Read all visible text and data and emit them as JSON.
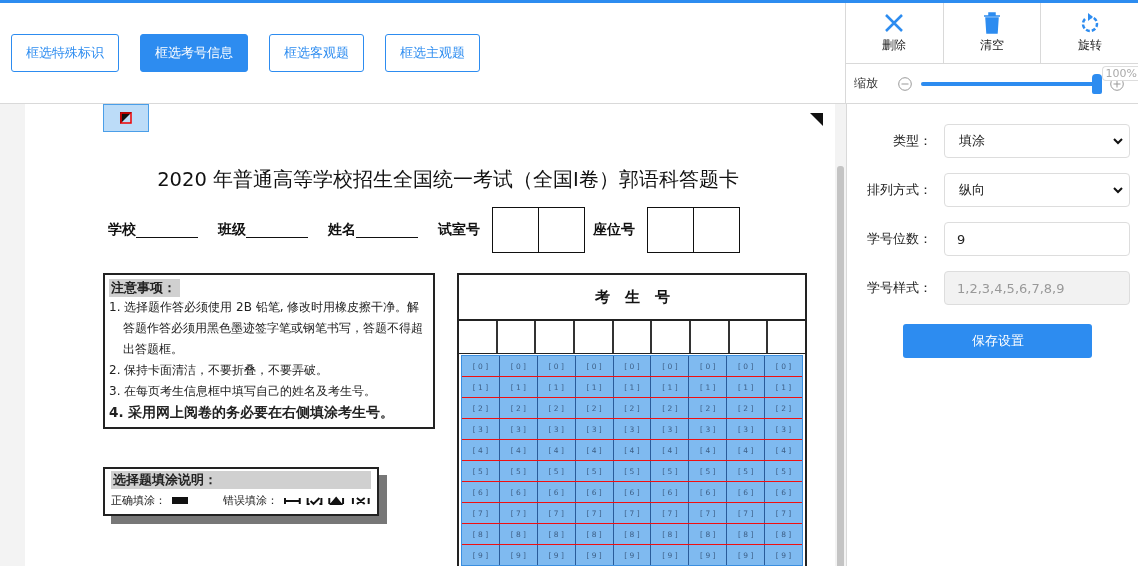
{
  "toolbar": {
    "buttons": [
      {
        "label": "框选特殊标识",
        "selected": false
      },
      {
        "label": "框选考号信息",
        "selected": true
      },
      {
        "label": "框选客观题",
        "selected": false
      },
      {
        "label": "框选主观题",
        "selected": false
      }
    ]
  },
  "tools": [
    {
      "kind": "delete",
      "label": "删除"
    },
    {
      "kind": "clear",
      "label": "清空"
    },
    {
      "kind": "rotate",
      "label": "旋转"
    }
  ],
  "zoom": {
    "label": "缩放",
    "level": 0.98,
    "reading": "100%"
  },
  "document": {
    "title": "2020 年普通高等学校招生全国统一考试（全国I卷）郭语科答题卡",
    "info": [
      {
        "kind": "line",
        "label": "学校"
      },
      {
        "kind": "line",
        "label": "班级"
      },
      {
        "kind": "line",
        "label": "姓名"
      },
      {
        "kind": "boxes",
        "label": "试室号"
      },
      {
        "kind": "boxes",
        "label": "座位号"
      }
    ],
    "notes": {
      "title": "注意事项：",
      "items": [
        {
          "text": "1. 选择题作答必须使用 2B 铅笔, 修改时用橡皮擦干净。解答题作答必须用黑色墨迹签字笔或钢笔书写，答题不得超出答题框。",
          "bold": false
        },
        {
          "text": "2. 保持卡面清洁，不要折叠，不要弄破。",
          "bold": false
        },
        {
          "text": "3. 在每页考生信息框中填写自己的姓名及考生号。",
          "bold": false
        },
        {
          "text": "4. 采用网上阅卷的务必要在右侧填涂考生号。",
          "bold": true
        }
      ]
    },
    "fill_guide": {
      "title": "选择题填涂说明：",
      "correct": "正确填涂：",
      "wrong": "错误填涂："
    },
    "grid": {
      "header": "考　生　号",
      "rows": [
        [
          "[ 0 ]",
          "[ 0 ]",
          "[ 0 ]",
          "[ 0 ]",
          "[ 0 ]",
          "[ 0 ]",
          "[ 0 ]",
          "[ 0 ]",
          "[ 0 ]"
        ],
        [
          "[ 1 ]",
          "[ 1 ]",
          "[ 1 ]",
          "[ 1 ]",
          "[ 1 ]",
          "[ 1 ]",
          "[ 1 ]",
          "[ 1 ]",
          "[ 1 ]"
        ],
        [
          "[ 2 ]",
          "[ 2 ]",
          "[ 2 ]",
          "[ 2 ]",
          "[ 2 ]",
          "[ 2 ]",
          "[ 2 ]",
          "[ 2 ]",
          "[ 2 ]"
        ],
        [
          "[ 3 ]",
          "[ 3 ]",
          "[ 3 ]",
          "[ 3 ]",
          "[ 3 ]",
          "[ 3 ]",
          "[ 3 ]",
          "[ 3 ]",
          "[ 3 ]"
        ],
        [
          "[ 4 ]",
          "[ 4 ]",
          "[ 4 ]",
          "[ 4 ]",
          "[ 4 ]",
          "[ 4 ]",
          "[ 4 ]",
          "[ 4 ]",
          "[ 4 ]"
        ],
        [
          "[ 5 ]",
          "[ 5 ]",
          "[ 5 ]",
          "[ 5 ]",
          "[ 5 ]",
          "[ 5 ]",
          "[ 5 ]",
          "[ 5 ]",
          "[ 5 ]"
        ],
        [
          "[ 6 ]",
          "[ 6 ]",
          "[ 6 ]",
          "[ 6 ]",
          "[ 6 ]",
          "[ 6 ]",
          "[ 6 ]",
          "[ 6 ]",
          "[ 6 ]"
        ],
        [
          "[ 7 ]",
          "[ 7 ]",
          "[ 7 ]",
          "[ 7 ]",
          "[ 7 ]",
          "[ 7 ]",
          "[ 7 ]",
          "[ 7 ]",
          "[ 7 ]"
        ],
        [
          "[ 8 ]",
          "[ 8 ]",
          "[ 8 ]",
          "[ 8 ]",
          "[ 8 ]",
          "[ 8 ]",
          "[ 8 ]",
          "[ 8 ]",
          "[ 8 ]"
        ],
        [
          "[ 9 ]",
          "[ 9 ]",
          "[ 9 ]",
          "[ 9 ]",
          "[ 9 ]",
          "[ 9 ]",
          "[ 9 ]",
          "[ 9 ]",
          "[ 9 ]"
        ]
      ]
    }
  },
  "settings": {
    "fields": [
      {
        "kind": "select",
        "label": "类型：",
        "value": "填涂"
      },
      {
        "kind": "select",
        "label": "排列方式：",
        "value": "纵向"
      },
      {
        "kind": "input",
        "label": "学号位数：",
        "value": "9"
      },
      {
        "kind": "readonly",
        "label": "学号样式：",
        "value": "1,2,3,4,5,6,7,8,9"
      }
    ],
    "save": "保存设置"
  }
}
